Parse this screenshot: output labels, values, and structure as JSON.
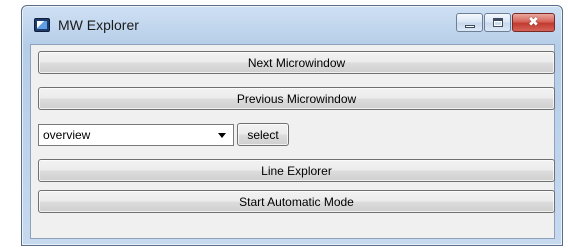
{
  "window": {
    "title": "MW Explorer"
  },
  "titlebar": {
    "icon": "app-window-icon",
    "buttons": [
      {
        "name": "minimize",
        "icon": "minimize-icon"
      },
      {
        "name": "maximize",
        "icon": "maximize-icon"
      },
      {
        "name": "close",
        "icon": "close-icon",
        "glyph": "✖"
      }
    ]
  },
  "main": {
    "next_label": "Next Microwindow",
    "previous_label": "Previous Microwindow",
    "selector": {
      "value": "overview",
      "button_label": "select"
    },
    "line_explorer_label": "Line Explorer",
    "automatic_label": "Start Automatic Mode"
  },
  "colors": {
    "window_frame": "#bdd3ec",
    "client_bg": "#f0f0f0",
    "close_red": "#c23a2f"
  }
}
